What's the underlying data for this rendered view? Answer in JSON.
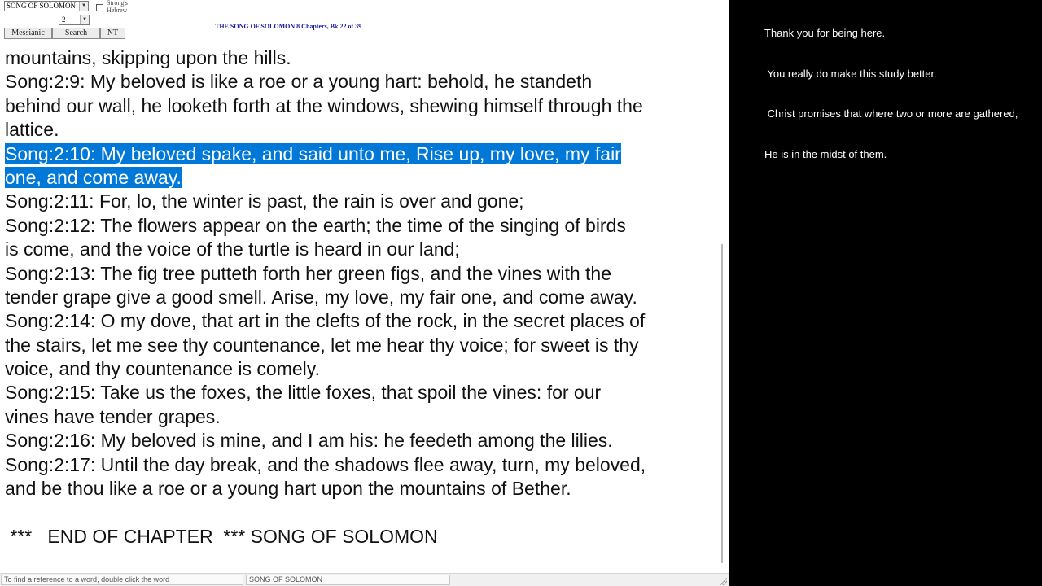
{
  "toolbar": {
    "book_select": "SONG OF SOLOMON",
    "chapter_select": "2",
    "strongs_label": "Strong's Hebrew",
    "messianic_label": "Messianic",
    "search_label": "Search",
    "nt_label": "NT",
    "header": "THE SONG OF SOLOMON 8 Chapters, Bk 22 of 39"
  },
  "text": {
    "lines": [
      "mountains, skipping upon the hills.",
      "Song:2:9: My beloved is like a roe or a young hart: behold, he standeth",
      "behind our wall, he looketh forth at the windows, shewing himself through the",
      "lattice.",
      "Song:2:10: My beloved spake, and said unto me, Rise up, my love, my fair",
      "one, and come away.",
      "Song:2:11: For, lo, the winter is past, the rain is over and gone;",
      "Song:2:12: The flowers appear on the earth; the time of the singing of birds",
      "is come, and the voice of the turtle is heard in our land;",
      "Song:2:13: The fig tree putteth forth her green figs, and the vines with the",
      "tender grape give a good smell.  Arise, my love, my fair one, and come away.",
      "Song:2:14: O my dove, that art in the clefts of the rock, in the secret places of",
      "the stairs, let me see thy countenance, let me hear thy voice; for sweet is thy",
      "voice, and thy countenance is comely.",
      "Song:2:15: Take us the foxes, the little foxes, that spoil the vines: for our",
      "vines have tender grapes.",
      "Song:2:16: My beloved is mine, and I am his: he feedeth among the lilies.",
      "Song:2:17: Until the day break, and the shadows flee away, turn, my beloved,",
      "and be thou like a roe or a young hart upon the mountains of Bether."
    ],
    "end_of_chapter": " ***   END OF CHAPTER  *** SONG OF SOLOMON"
  },
  "status": {
    "hint": "To find a reference to a word, double click the word",
    "book": "SONG OF SOLOMON"
  },
  "chat": {
    "lines": [
      "Thank you for being here.",
      " You really do make this study better.",
      " Christ promises that where two or more are gathered,",
      "He is in the midst of them."
    ]
  },
  "colors": {
    "selection": "#0078d7",
    "header_text": "#1a1aa6",
    "background_right": "#000000"
  }
}
